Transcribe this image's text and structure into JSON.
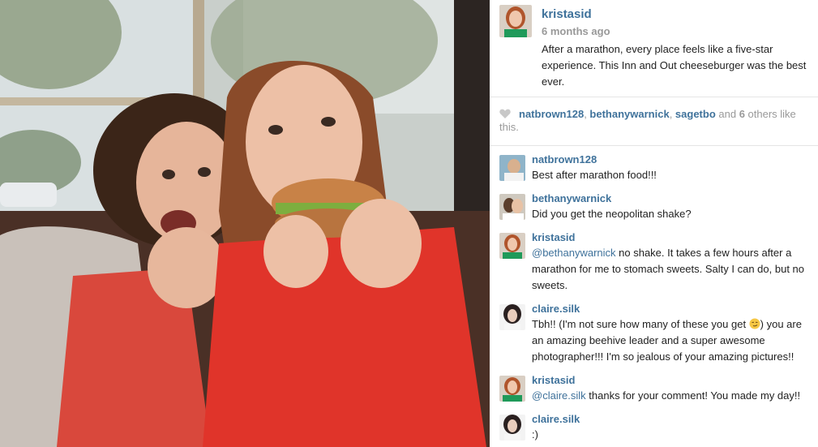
{
  "post": {
    "author": "kristasid",
    "time_ago": "6 months ago",
    "caption": "After a marathon, every place feels like a five-star experience. This Inn and Out cheeseburger was the best ever."
  },
  "likes": {
    "heart_icon": "heart-icon",
    "users": [
      "natbrown128",
      "bethanywarnick",
      "sagetbo"
    ],
    "sep1": ", ",
    "sep2": ", ",
    "and_text": " and ",
    "others_count": "6",
    "others_suffix": " others like this."
  },
  "comments": [
    {
      "user": "natbrown128",
      "text": "Best after marathon food!!!"
    },
    {
      "user": "bethanywarnick",
      "text": "Did you get the neopolitan shake?"
    },
    {
      "user": "kristasid",
      "mention": "@bethanywarnick",
      "text": " no shake. It takes a few hours after a marathon for me to stomach sweets. Salty I can do, but no sweets."
    },
    {
      "user": "claire.silk",
      "text_before": "Tbh!! (I'm not sure how many of these you get ",
      "emoji": "smirk-emoji",
      "text_after": ") you are an amazing beehive leader and a super awesome photographer!!! I'm so jealous of your amazing pictures!!"
    },
    {
      "user": "kristasid",
      "mention": "@claire.silk",
      "text": " thanks for your comment! You made my day!!"
    },
    {
      "user": "claire.silk",
      "text": ":)"
    }
  ],
  "colors": {
    "username": "#3f729b",
    "muted": "#999999",
    "text": "#222222",
    "divider": "#e5e5e5"
  }
}
